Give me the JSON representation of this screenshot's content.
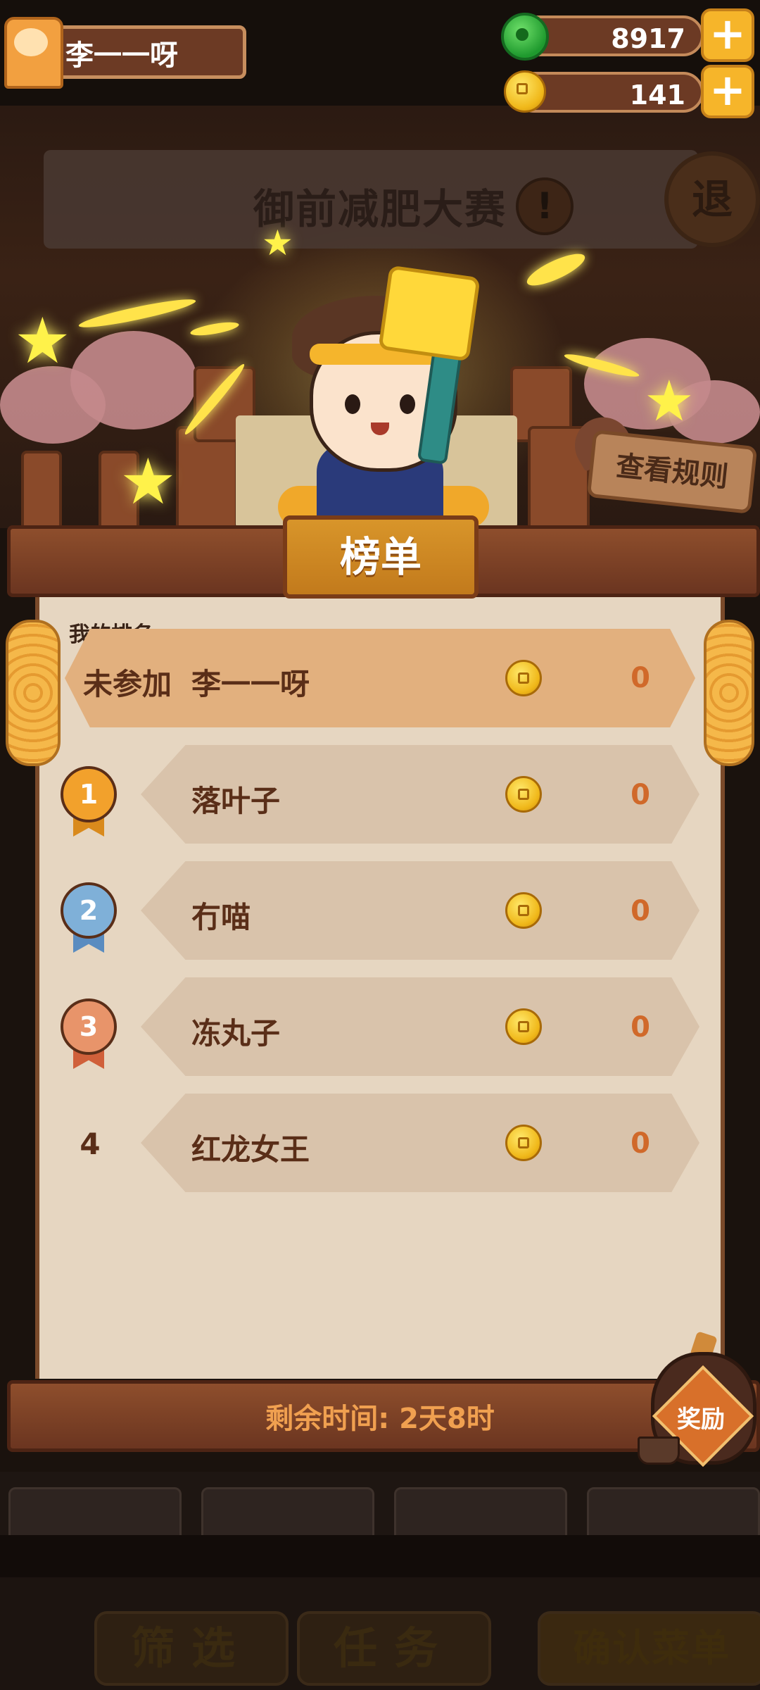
{
  "player": {
    "name": "李一一呀"
  },
  "resources": {
    "jade": {
      "value": "8917",
      "plus": "+"
    },
    "coins": {
      "value": "141",
      "plus": "+"
    }
  },
  "event": {
    "title": "御前减肥大赛",
    "warning_icon": "!",
    "exit_label": "退"
  },
  "rules_button": "查看规则",
  "leaderboard": {
    "title": "榜单",
    "my_rank_label": "我的排名",
    "my_entry": {
      "status": "未参加",
      "name": "李一一呀",
      "score": "0"
    },
    "entries": [
      {
        "rank": "1",
        "name": "落叶子",
        "score": "0",
        "medal_color": "#f2a12c"
      },
      {
        "rank": "2",
        "name": "冇喵",
        "score": "0",
        "medal_color": "#7fb0d8"
      },
      {
        "rank": "3",
        "name": "冻丸子",
        "score": "0",
        "medal_color": "#e8946a"
      },
      {
        "rank": "4",
        "name": "红龙女王",
        "score": "0"
      }
    ],
    "remaining_time": "剩余时间: 2天8时"
  },
  "reward_button": "奖励",
  "bottom_bar": {
    "filter": "筛选",
    "tasks": "任务",
    "confirm_menu": "确认菜单"
  },
  "colors": {
    "panel": "#e6d6c1",
    "row": "#d9c3ab",
    "my_row": "#e2b07e",
    "score": "#d0692a",
    "wood": "#7a3e22"
  }
}
